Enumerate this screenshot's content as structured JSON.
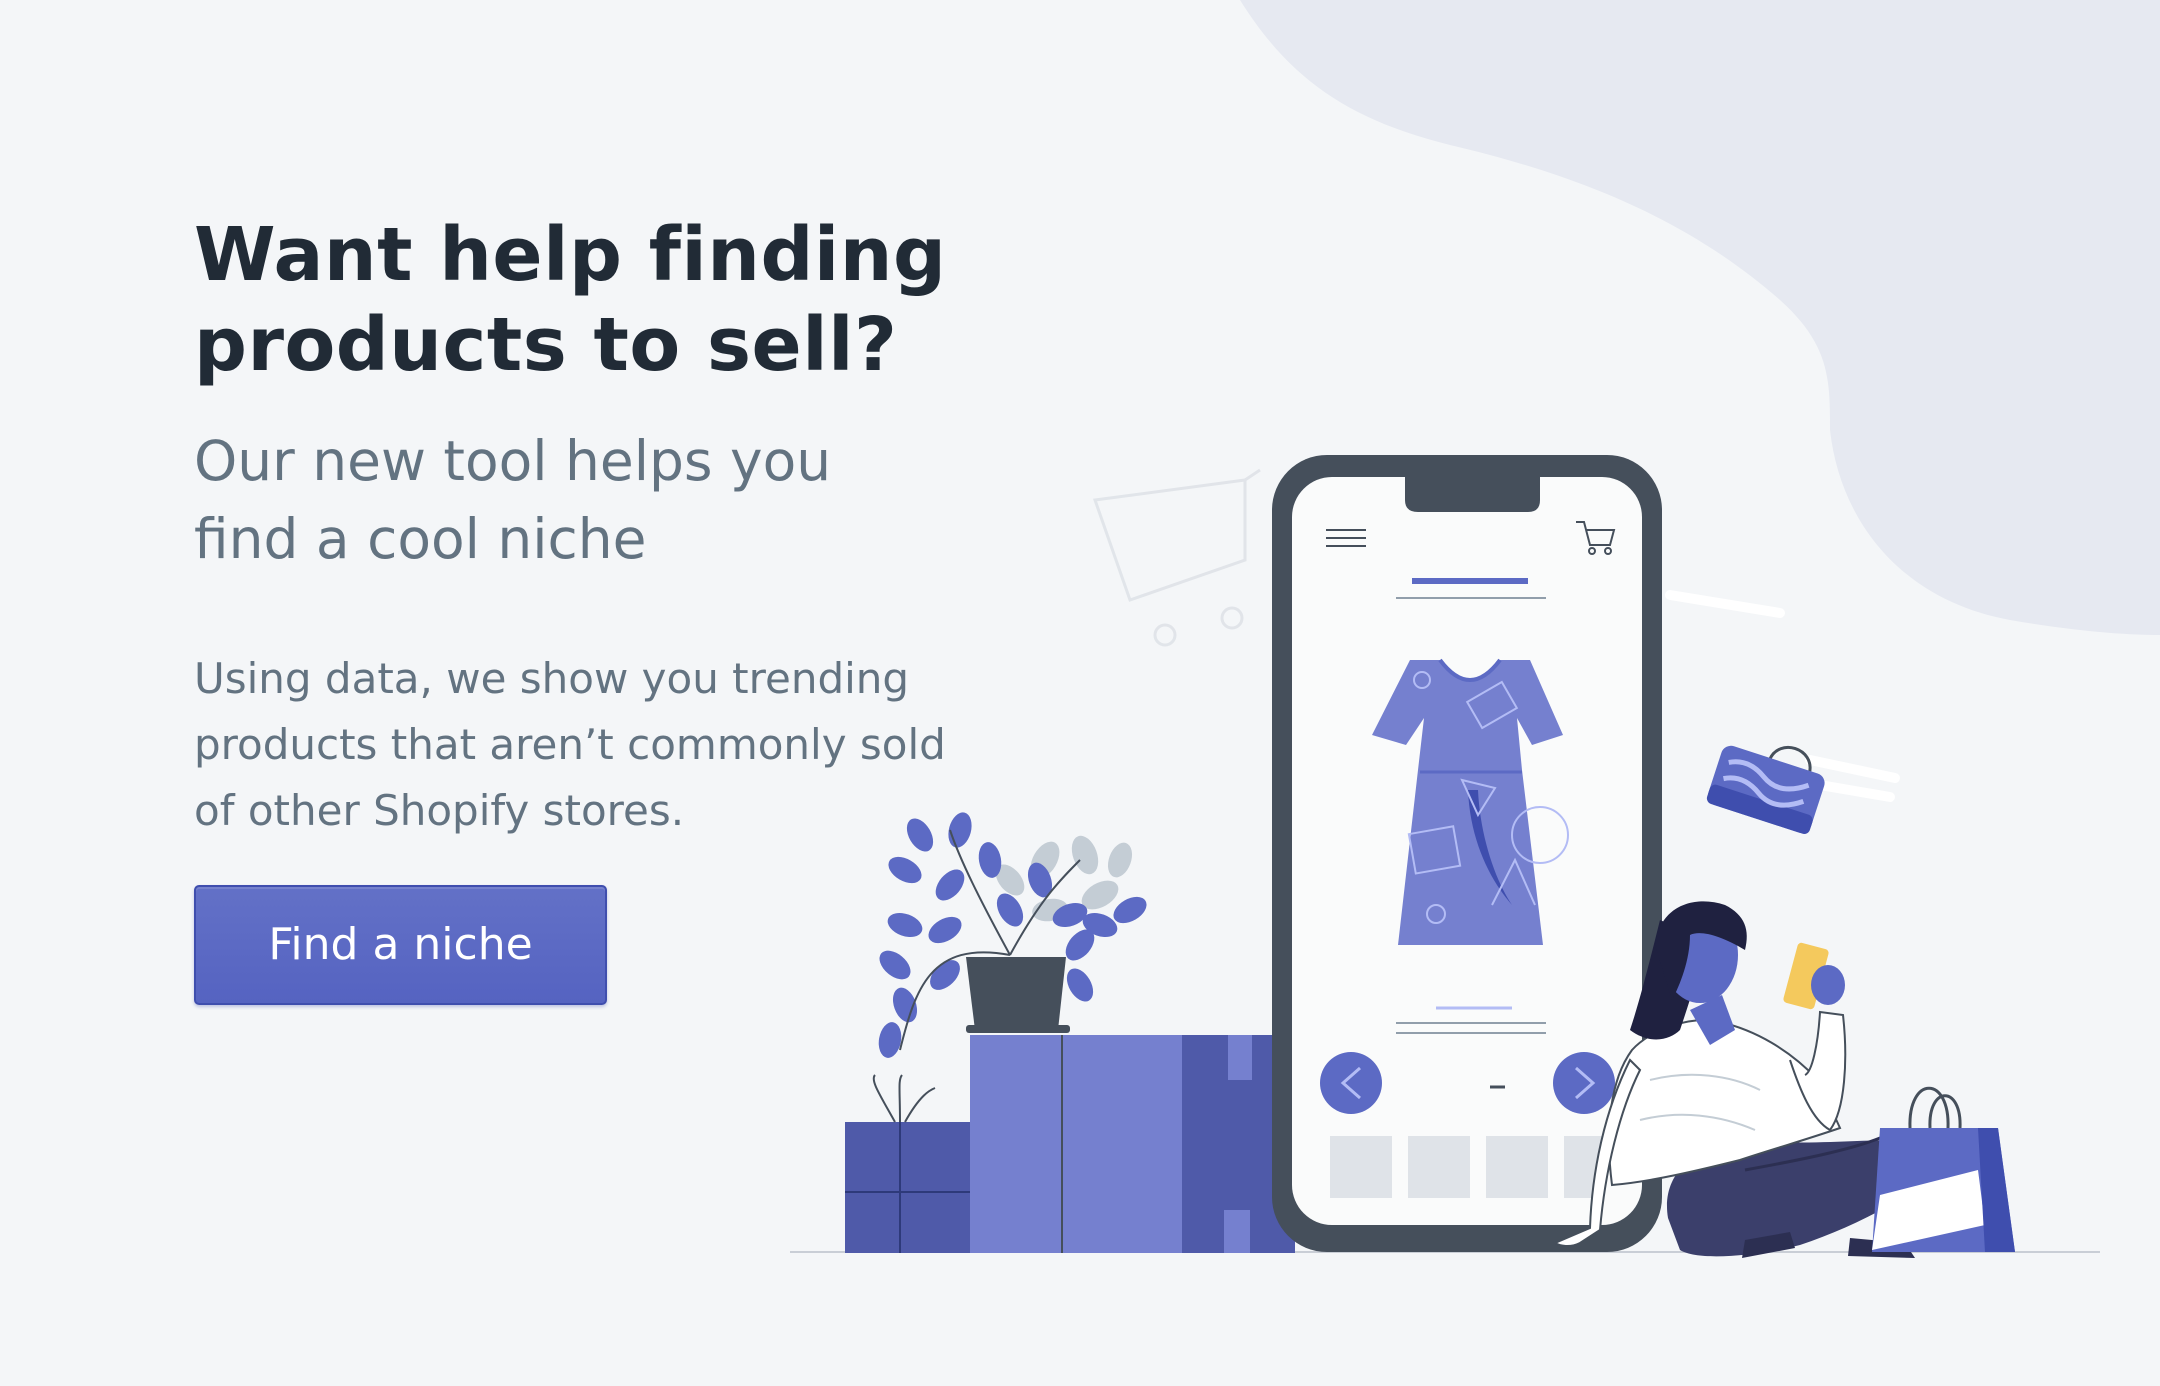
{
  "hero": {
    "headline": "Want help finding products to sell?",
    "subheadline": "Our new tool helps you find a cool niche",
    "body": "Using data, we show you trending products that aren’t commonly sold of other Shopify stores.",
    "cta_label": "Find a niche"
  },
  "colors": {
    "background": "#f4f6f8",
    "blob": "#e6e9f1",
    "accent": "#5c6ac4",
    "heading": "#212b36",
    "body_text": "#637381"
  }
}
